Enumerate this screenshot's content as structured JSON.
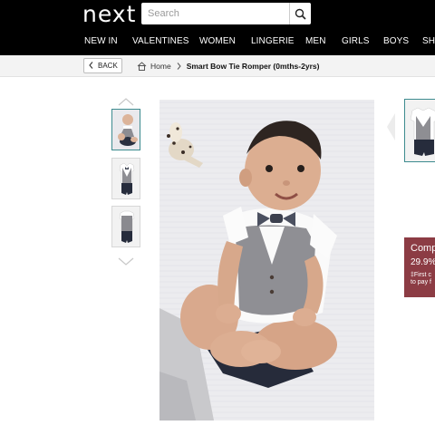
{
  "header": {
    "logo": "next",
    "search": {
      "placeholder": "Search",
      "icon": "search-icon"
    },
    "nav": [
      "NEW IN",
      "VALENTINES",
      "WOMEN",
      "LINGERIE",
      "MEN",
      "GIRLS",
      "BOYS",
      "SH"
    ]
  },
  "breadcrumb": {
    "back_label": "BACK",
    "home_label": "Home",
    "current": "Smart Bow Tie Romper (0mths-2yrs)"
  },
  "gallery": {
    "thumbnails": [
      "photo-baby-front",
      "romper-front",
      "romper-back"
    ],
    "active_index": 0,
    "main_image": "baby-wearing-bow-tie-romper"
  },
  "promo": {
    "line1": "Comp",
    "line2": "29.9%",
    "line3a": "‡First c",
    "line3b": "to pay f",
    "color": "#8c3c44"
  },
  "colors": {
    "accent": "#3d8b8f",
    "header_bg": "#000000"
  }
}
